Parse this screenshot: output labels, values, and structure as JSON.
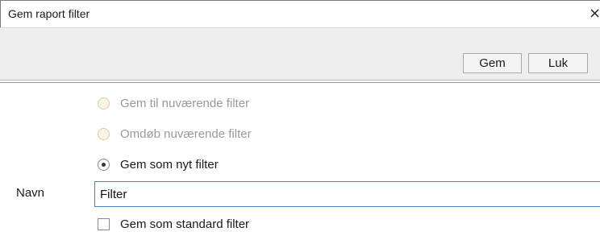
{
  "dialog": {
    "title": "Gem raport filter",
    "close_glyph": "×"
  },
  "toolbar": {
    "save_label": "Gem",
    "close_label": "Luk"
  },
  "options": [
    {
      "label": "Gem til nuværende filter",
      "selected": false,
      "enabled": false
    },
    {
      "label": "Omdøb nuværende filter",
      "selected": false,
      "enabled": false
    },
    {
      "label": "Gem som nyt filter",
      "selected": true,
      "enabled": true
    }
  ],
  "name_field": {
    "label": "Navn",
    "value": "Filter"
  },
  "default_checkbox": {
    "label": "Gem som standard filter",
    "checked": false
  }
}
